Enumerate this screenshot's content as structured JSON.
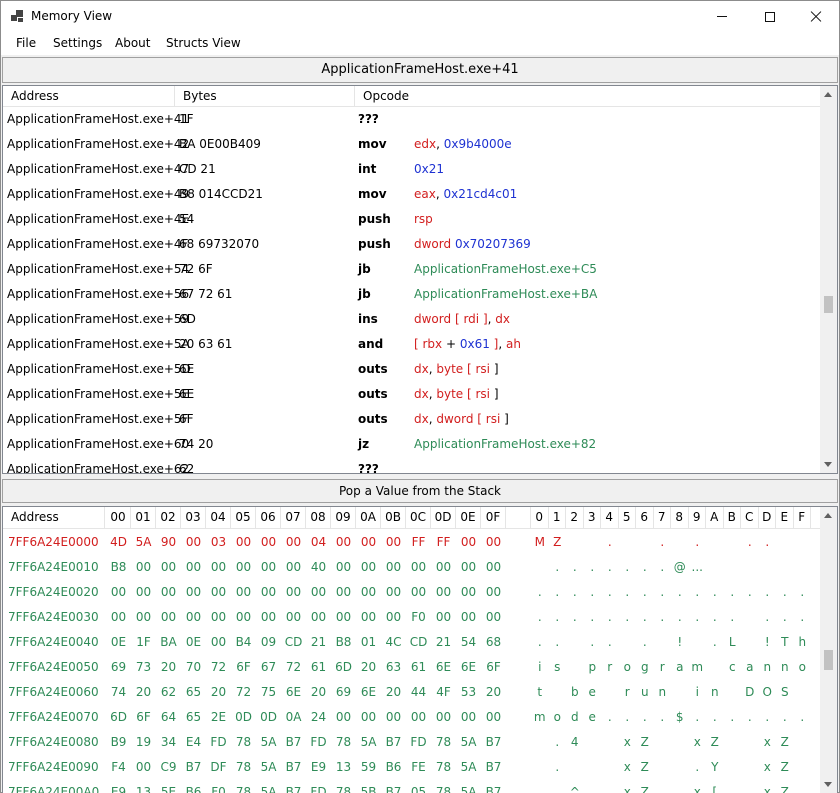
{
  "window": {
    "title": "Memory View"
  },
  "menu": [
    "File",
    "Settings",
    "About",
    "Structs View"
  ],
  "address_bar": "ApplicationFrameHost.exe+41",
  "disasm": {
    "headers": {
      "address": "Address",
      "bytes": "Bytes",
      "opcode": "Opcode"
    },
    "rows": [
      {
        "address": "ApplicationFrameHost.exe+41",
        "bytes": "1F",
        "mnemonic": "???",
        "operands": []
      },
      {
        "address": "ApplicationFrameHost.exe+42",
        "bytes": "BA 0E00B409",
        "mnemonic": "mov",
        "operands": [
          [
            "edx",
            "reg"
          ],
          [
            ", ",
            "pun"
          ],
          [
            "0x9b4000e",
            "num"
          ]
        ]
      },
      {
        "address": "ApplicationFrameHost.exe+47",
        "bytes": "CD 21",
        "mnemonic": "int",
        "operands": [
          [
            "0x21",
            "num"
          ]
        ]
      },
      {
        "address": "ApplicationFrameHost.exe+49",
        "bytes": "B8 014CCD21",
        "mnemonic": "mov",
        "operands": [
          [
            "eax",
            "reg"
          ],
          [
            ", ",
            "pun"
          ],
          [
            "0x21cd4c01",
            "num"
          ]
        ]
      },
      {
        "address": "ApplicationFrameHost.exe+4E",
        "bytes": "54",
        "mnemonic": "push",
        "operands": [
          [
            "rsp",
            "reg"
          ]
        ]
      },
      {
        "address": "ApplicationFrameHost.exe+4F",
        "bytes": "68 69732070",
        "mnemonic": "push",
        "operands": [
          [
            "dword ",
            "reg"
          ],
          [
            "0x70207369",
            "num"
          ]
        ]
      },
      {
        "address": "ApplicationFrameHost.exe+54",
        "bytes": "72 6F",
        "mnemonic": "jb",
        "operands": [
          [
            "ApplicationFrameHost.exe+C5",
            "sym"
          ]
        ]
      },
      {
        "address": "ApplicationFrameHost.exe+56",
        "bytes": "67 72 61",
        "mnemonic": "jb",
        "operands": [
          [
            "ApplicationFrameHost.exe+BA",
            "sym"
          ]
        ]
      },
      {
        "address": "ApplicationFrameHost.exe+59",
        "bytes": "6D",
        "mnemonic": "ins",
        "operands": [
          [
            "dword ",
            "reg"
          ],
          [
            "[ ",
            "reg"
          ],
          [
            "rdi",
            "reg"
          ],
          [
            " ]",
            "reg"
          ],
          [
            ", ",
            "pun"
          ],
          [
            "dx",
            "reg"
          ]
        ]
      },
      {
        "address": "ApplicationFrameHost.exe+5A",
        "bytes": "20 63 61",
        "mnemonic": "and",
        "operands": [
          [
            "[ ",
            "reg"
          ],
          [
            "rbx",
            "reg"
          ],
          [
            " + ",
            "pun"
          ],
          [
            "0x61",
            "num"
          ],
          [
            " ]",
            "reg"
          ],
          [
            ", ",
            "pun"
          ],
          [
            "ah",
            "reg"
          ]
        ]
      },
      {
        "address": "ApplicationFrameHost.exe+5D",
        "bytes": "6E",
        "mnemonic": "outs",
        "operands": [
          [
            "dx",
            "reg"
          ],
          [
            ", ",
            "pun"
          ],
          [
            "byte ",
            "reg"
          ],
          [
            "[ ",
            "reg"
          ],
          [
            "rsi",
            "reg"
          ],
          [
            " ]",
            "pun"
          ]
        ]
      },
      {
        "address": "ApplicationFrameHost.exe+5E",
        "bytes": "6E",
        "mnemonic": "outs",
        "operands": [
          [
            "dx",
            "reg"
          ],
          [
            ", ",
            "pun"
          ],
          [
            "byte ",
            "reg"
          ],
          [
            "[ ",
            "reg"
          ],
          [
            "rsi",
            "reg"
          ],
          [
            " ]",
            "pun"
          ]
        ]
      },
      {
        "address": "ApplicationFrameHost.exe+5F",
        "bytes": "6F",
        "mnemonic": "outs",
        "operands": [
          [
            "dx",
            "reg"
          ],
          [
            ", ",
            "pun"
          ],
          [
            "dword ",
            "reg"
          ],
          [
            "[ ",
            "reg"
          ],
          [
            "rsi",
            "reg"
          ],
          [
            " ]",
            "pun"
          ]
        ]
      },
      {
        "address": "ApplicationFrameHost.exe+60",
        "bytes": "74 20",
        "mnemonic": "jz",
        "operands": [
          [
            "ApplicationFrameHost.exe+82",
            "sym"
          ]
        ]
      },
      {
        "address": "ApplicationFrameHost.exe+62",
        "bytes": "62",
        "mnemonic": "???",
        "operands": []
      }
    ]
  },
  "status_text": "Pop a Value from the Stack",
  "hex": {
    "header_address": "Address",
    "byte_columns": [
      "00",
      "01",
      "02",
      "03",
      "04",
      "05",
      "06",
      "07",
      "08",
      "09",
      "0A",
      "0B",
      "0C",
      "0D",
      "0E",
      "0F"
    ],
    "ascii_columns": [
      "0",
      "1",
      "2",
      "3",
      "4",
      "5",
      "6",
      "7",
      "8",
      "9",
      "A",
      "B",
      "C",
      "D",
      "E",
      "F"
    ],
    "rows": [
      {
        "address": "7FF6A24E0000",
        "color": "red",
        "bytes": [
          "4D",
          "5A",
          "90",
          "00",
          "03",
          "00",
          "00",
          "00",
          "04",
          "00",
          "00",
          "00",
          "FF",
          "FF",
          "00",
          "00"
        ],
        "ascii": [
          "M",
          "Z",
          "",
          "",
          ".",
          "",
          "",
          ".",
          "",
          ".",
          "",
          "",
          ".",
          ".",
          "",
          ""
        ]
      },
      {
        "address": "7FF6A24E0010",
        "color": "green",
        "bytes": [
          "B8",
          "00",
          "00",
          "00",
          "00",
          "00",
          "00",
          "00",
          "40",
          "00",
          "00",
          "00",
          "00",
          "00",
          "00",
          "00"
        ],
        "ascii": [
          "",
          ".",
          ".",
          ".",
          ".",
          ".",
          ".",
          ".",
          "@",
          "...",
          "",
          "",
          "",
          "",
          "",
          ""
        ]
      },
      {
        "address": "7FF6A24E0020",
        "color": "green",
        "bytes": [
          "00",
          "00",
          "00",
          "00",
          "00",
          "00",
          "00",
          "00",
          "00",
          "00",
          "00",
          "00",
          "00",
          "00",
          "00",
          "00"
        ],
        "ascii": [
          ".",
          ".",
          ".",
          ".",
          ".",
          ".",
          ".",
          ".",
          ".",
          ".",
          ".",
          ".",
          ".",
          ".",
          ".",
          "."
        ]
      },
      {
        "address": "7FF6A24E0030",
        "color": "green",
        "bytes": [
          "00",
          "00",
          "00",
          "00",
          "00",
          "00",
          "00",
          "00",
          "00",
          "00",
          "00",
          "00",
          "F0",
          "00",
          "00",
          "00"
        ],
        "ascii": [
          ".",
          ".",
          ".",
          ".",
          ".",
          ".",
          ".",
          ".",
          ".",
          ".",
          ".",
          ".",
          "",
          ".",
          ".",
          "."
        ]
      },
      {
        "address": "7FF6A24E0040",
        "color": "green",
        "bytes": [
          "0E",
          "1F",
          "BA",
          "0E",
          "00",
          "B4",
          "09",
          "CD",
          "21",
          "B8",
          "01",
          "4C",
          "CD",
          "21",
          "54",
          "68"
        ],
        "ascii": [
          ".",
          ".",
          "",
          ".",
          ".",
          "",
          ".",
          "",
          "!",
          "",
          ".",
          "L",
          "",
          "!",
          "T",
          "h"
        ]
      },
      {
        "address": "7FF6A24E0050",
        "color": "green",
        "bytes": [
          "69",
          "73",
          "20",
          "70",
          "72",
          "6F",
          "67",
          "72",
          "61",
          "6D",
          "20",
          "63",
          "61",
          "6E",
          "6E",
          "6F"
        ],
        "ascii": [
          "i",
          "s",
          "",
          "p",
          "r",
          "o",
          "g",
          "r",
          "a",
          "m",
          "",
          "c",
          "a",
          "n",
          "n",
          "o"
        ]
      },
      {
        "address": "7FF6A24E0060",
        "color": "green",
        "bytes": [
          "74",
          "20",
          "62",
          "65",
          "20",
          "72",
          "75",
          "6E",
          "20",
          "69",
          "6E",
          "20",
          "44",
          "4F",
          "53",
          "20"
        ],
        "ascii": [
          "t",
          "",
          "b",
          "e",
          "",
          "r",
          "u",
          "n",
          "",
          "i",
          "n",
          "",
          "D",
          "O",
          "S",
          ""
        ]
      },
      {
        "address": "7FF6A24E0070",
        "color": "green",
        "bytes": [
          "6D",
          "6F",
          "64",
          "65",
          "2E",
          "0D",
          "0D",
          "0A",
          "24",
          "00",
          "00",
          "00",
          "00",
          "00",
          "00",
          "00"
        ],
        "ascii": [
          "m",
          "o",
          "d",
          "e",
          ".",
          ".",
          ".",
          ".",
          "$",
          ".",
          ".",
          ".",
          ".",
          ".",
          ".",
          "."
        ]
      },
      {
        "address": "7FF6A24E0080",
        "color": "green",
        "bytes": [
          "B9",
          "19",
          "34",
          "E4",
          "FD",
          "78",
          "5A",
          "B7",
          "FD",
          "78",
          "5A",
          "B7",
          "FD",
          "78",
          "5A",
          "B7"
        ],
        "ascii": [
          "",
          ".",
          "4",
          "",
          "",
          "x",
          "Z",
          "",
          "",
          "x",
          "Z",
          "",
          "",
          "x",
          "Z",
          ""
        ]
      },
      {
        "address": "7FF6A24E0090",
        "color": "green",
        "bytes": [
          "F4",
          "00",
          "C9",
          "B7",
          "DF",
          "78",
          "5A",
          "B7",
          "E9",
          "13",
          "59",
          "B6",
          "FE",
          "78",
          "5A",
          "B7"
        ],
        "ascii": [
          "",
          ".",
          "",
          "",
          "",
          "x",
          "Z",
          "",
          "",
          ".",
          "Y",
          "",
          "",
          "x",
          "Z",
          ""
        ]
      },
      {
        "address": "7FF6A24E00A0",
        "color": "green",
        "bytes": [
          "E9",
          "13",
          "5E",
          "B6",
          "F0",
          "78",
          "5A",
          "B7",
          "FD",
          "78",
          "5B",
          "B7",
          "05",
          "78",
          "5A",
          "B7"
        ],
        "ascii": [
          "",
          ".",
          "^",
          "",
          "",
          "x",
          "Z",
          "",
          "",
          "x",
          "[",
          "",
          ".",
          "x",
          "Z",
          ""
        ]
      }
    ]
  },
  "colors": {
    "register": "#d21e1e",
    "number": "#1e32d2",
    "symbol": "#2e8b57",
    "highlight": "#d21e1e",
    "bytes": "#2e8b57"
  }
}
